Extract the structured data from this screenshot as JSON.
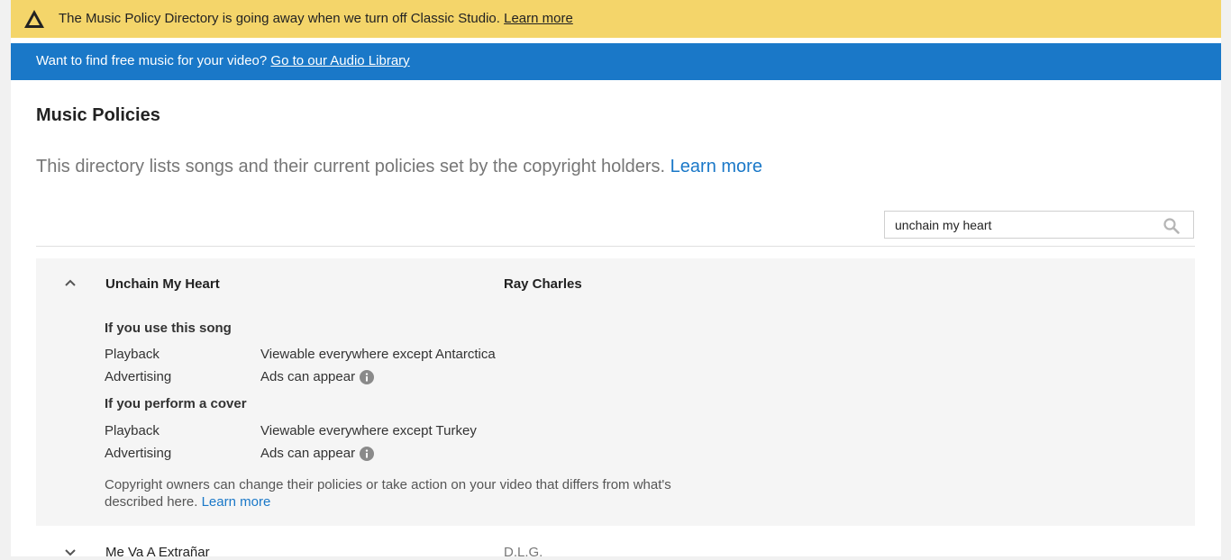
{
  "warning_banner": {
    "icon": "warning-triangle-icon",
    "message": "The Music Policy Directory is going away when we turn off Classic Studio.",
    "link": "Learn more"
  },
  "info_banner": {
    "message": "Want to find free music for your video?",
    "link": "Go to our Audio Library"
  },
  "page": {
    "title": "Music Policies",
    "description": "This directory lists songs and their current policies set by the copyright holders.",
    "description_link": "Learn more"
  },
  "search": {
    "value": "unchain my heart",
    "icon": "search-icon"
  },
  "results": [
    {
      "title": "Unchain My Heart",
      "artist": "Ray Charles",
      "expanded": true,
      "use_heading": "If you use this song",
      "use_rows": [
        {
          "label": "Playback",
          "value": "Viewable everywhere except Antarctica"
        },
        {
          "label": "Advertising",
          "value": "Ads can appear"
        }
      ],
      "cover_heading": "If you perform a cover",
      "cover_rows": [
        {
          "label": "Playback",
          "value": "Viewable everywhere except Turkey"
        },
        {
          "label": "Advertising",
          "value": "Ads can appear"
        }
      ],
      "note": "Copyright owners can change their policies or take action on your video that differs from what's described here.",
      "note_link": "Learn more"
    },
    {
      "title": "Me Va A Extrañar",
      "artist": "D.L.G.",
      "expanded": false
    }
  ],
  "colors": {
    "warning_bg": "#f4d56a",
    "info_bg": "#1a78c8",
    "link": "#1a78c8",
    "expanded_row_bg": "#f5f5f5"
  }
}
